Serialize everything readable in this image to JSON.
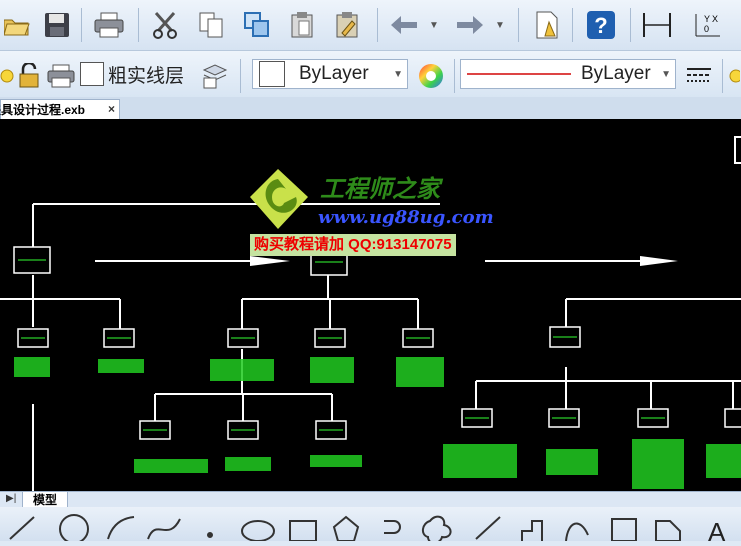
{
  "toolbar_standard": {
    "tools": [
      "open-icon",
      "save-icon",
      "print-icon",
      "cut-icon",
      "copy-icon",
      "copy-clip-icon",
      "clipboard-icon",
      "paste-icon",
      "undo-icon",
      "redo-icon",
      "match-properties-icon",
      "help-icon",
      "dimension-icon",
      "ucs-icon"
    ]
  },
  "toolbar_properties": {
    "linetype_name": "粗实线层",
    "color_value": "ByLayer",
    "lineweight_value": "ByLayer"
  },
  "document_tab": {
    "label": "夹具设计过程.exb",
    "close": "×"
  },
  "watermark": {
    "site_title": "工程师之家",
    "url": "www.ug88ug.com",
    "promo": "购买教程请加 QQ:913147075"
  },
  "model_tab": {
    "label": "模型"
  },
  "colors": {
    "canvas": "#000000",
    "box_stroke": "#ffffff",
    "box_text": "#33ff33",
    "bar_text": "#22dd22",
    "watermark_green": "#2e8b1a"
  }
}
